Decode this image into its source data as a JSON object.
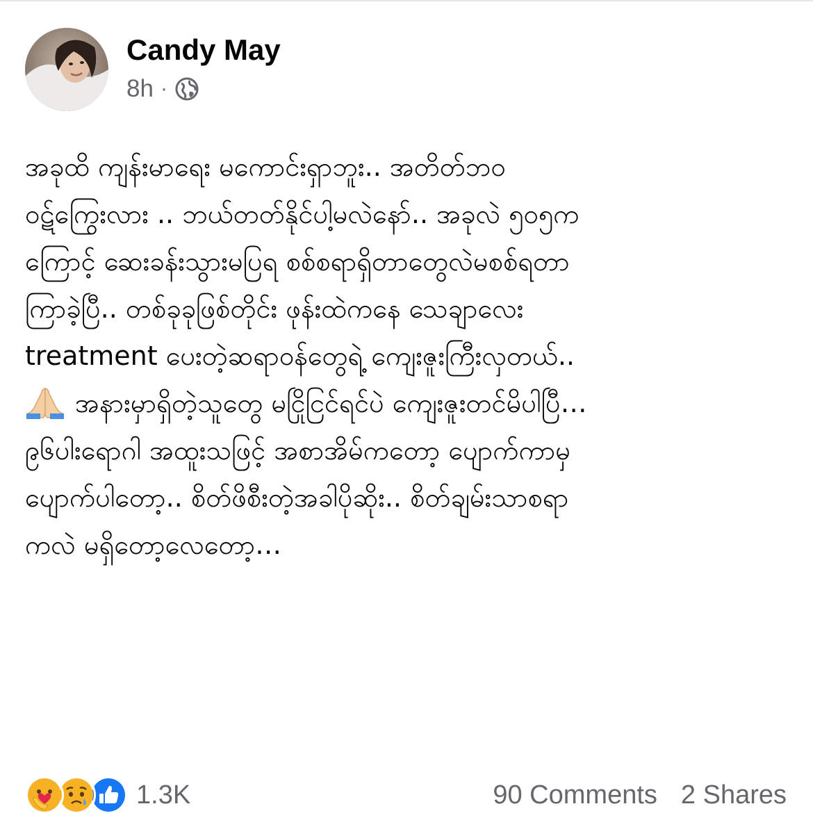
{
  "post": {
    "author": "Candy May",
    "timestamp": "8h",
    "separator": "·",
    "privacy_icon": "globe-icon",
    "lines": [
      "အခုထိ ကျန်းမာရေး မကောင်းရှာဘူး..  အတိတ်ဘဝ",
      "ဝဋ်ကြွေးလား .. ဘယ်တတ်နိုင်ပါ့မလဲနော်..  အခုလဲ ၅၀၅က",
      "ကြောင့် ဆေးခန်းသွားမပြရ စစ်စရာရှိတာတွေလဲမစစ်ရတာ",
      "ကြာခဲ့ပြီ.. တစ်ခုခုဖြစ်တိုင်း ဖုန်းထဲကနေ သေချာလေး",
      "treatment ပေးတဲ့ဆရာဝန်တွေရဲ့ ကျေးဇူးကြီးလှတယ်..",
      "အနားမှာရှိတဲ့သူတွေ မငြိုငြင်ရင်ပဲ ကျေးဇူးတင်မိပါပြီ…",
      "၉၆ပါးရောဂါ အထူးသဖြင့် အစာအိမ်ကတော့ ပျောက်ကာမှ",
      "ပျောက်ပါတော့..  စိတ်ဖိစီးတဲ့အခါပိုဆိုး.. စိတ်ချမ်းသာစရာ",
      "ကလဲ မရှိတော့လေတော့…"
    ],
    "inline_emoji_line_index": 5,
    "inline_emoji": "folded-hands-icon"
  },
  "footer": {
    "reaction_icons": [
      "care-reaction-icon",
      "sad-reaction-icon",
      "like-reaction-icon"
    ],
    "reaction_count": "1.3K",
    "comments": "90 Comments",
    "shares": "2 Shares"
  },
  "colors": {
    "text": "#050505",
    "secondary_text": "#65676b",
    "like_blue": "#1877f2",
    "reaction_yellow": "#f7b125"
  }
}
